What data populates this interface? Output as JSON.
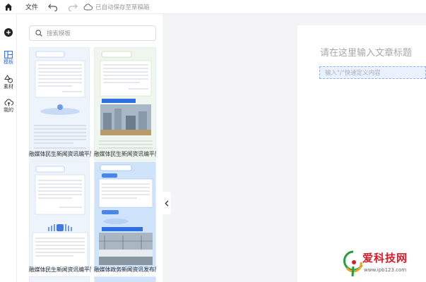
{
  "toolbar": {
    "file_label": "文件",
    "autosave_text": "已自动保存至草稿箱"
  },
  "rail": {
    "items": [
      {
        "label": ""
      },
      {
        "label": "模板"
      },
      {
        "label": "素材"
      },
      {
        "label": "我的"
      }
    ]
  },
  "panel": {
    "search_placeholder": "搜索模板",
    "templates": [
      {
        "name": "融媒体民生新闻资讯编平简..."
      },
      {
        "name": "融媒体民生新闻资讯编平简..."
      },
      {
        "name": "融媒体民生新闻资讯编平简..."
      },
      {
        "name": "融媒体政务新闻资讯发布简..."
      }
    ]
  },
  "editor": {
    "title_placeholder": "请在这里输入文章标题",
    "intro_placeholder": "输入\"/\"快速定义内容"
  },
  "watermark": {
    "brand": "爱科技网",
    "url": "www.ipb123.com"
  },
  "colors": {
    "accent": "#2f6fe0",
    "card_bg": "#eef4fc"
  }
}
